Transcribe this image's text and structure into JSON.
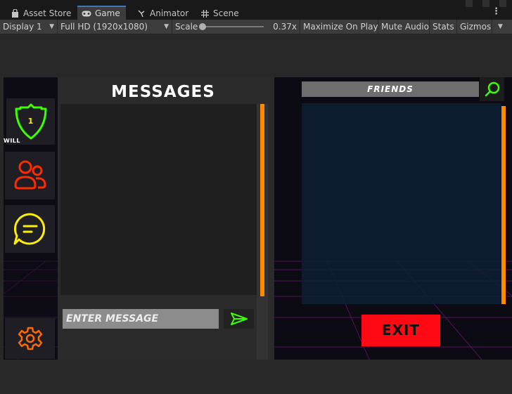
{
  "editor": {
    "tabs": [
      {
        "label": "Asset Store",
        "icon": "shopping-bag-icon"
      },
      {
        "label": "Game",
        "icon": "gamepad-icon"
      },
      {
        "label": "Animator",
        "icon": "animator-icon"
      },
      {
        "label": "Scene",
        "icon": "grid-icon"
      }
    ],
    "active_tab": "Game",
    "accent": "#3a79bb"
  },
  "toolbar": {
    "display": "Display 1",
    "resolution": "Full HD (1920x1080)",
    "scale_label": "Scale",
    "scale_value": "0.37x",
    "scale_fraction": 0.0,
    "maximize": "Maximize On Play",
    "mute": "Mute Audio",
    "stats": "Stats",
    "gizmos": "Gizmos"
  },
  "game": {
    "player": {
      "rank": "1",
      "name": "WILL"
    },
    "nav_icons": [
      "shield-icon",
      "friends-icon",
      "chat-icon",
      "gear-icon"
    ],
    "messages": {
      "title": "MESSAGES",
      "input_placeholder": "ENTER MESSAGE",
      "send_icon": "send-icon"
    },
    "friends": {
      "title": "FRIENDS",
      "search_icon": "search-icon"
    },
    "exit_label": "EXIT",
    "colors": {
      "scrollbar": "#ff8a00",
      "exit": "#ff0a14",
      "shield": "#3cff00",
      "friends_icon": "#ff2a00",
      "chat_icon": "#ffee00",
      "gear_icon": "#ff6a00",
      "grid": "#7a1a7a"
    }
  }
}
